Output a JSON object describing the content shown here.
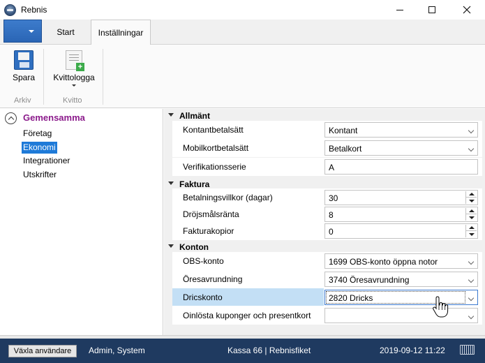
{
  "window": {
    "title": "Rebnis"
  },
  "tabs": {
    "start": "Start",
    "settings": "Inställningar"
  },
  "ribbon": {
    "save_label": "Spara",
    "archive_group": "Arkiv",
    "receipt_logo_label": "Kvittologga",
    "receipt_group": "Kvitto"
  },
  "tree": {
    "root": "Gemensamma",
    "items": [
      "Företag",
      "Ekonomi",
      "Integrationer",
      "Utskrifter"
    ],
    "selected": "Ekonomi"
  },
  "grid": {
    "categories": {
      "general": "Allmänt",
      "invoice": "Faktura",
      "accounts": "Konton"
    },
    "general": [
      {
        "name": "Kontantbetalsätt",
        "value": "Kontant"
      },
      {
        "name": "Mobilkortbetalsätt",
        "value": "Betalkort"
      },
      {
        "name": "Verifikationsserie",
        "value": "A"
      }
    ],
    "invoice": [
      {
        "name": "Betalningsvillkor (dagar)",
        "value": "30"
      },
      {
        "name": "Dröjsmålsränta",
        "value": "8"
      },
      {
        "name": "Fakturakopior",
        "value": "0"
      }
    ],
    "accounts": [
      {
        "name": "OBS-konto",
        "value": "1699 OBS-konto öppna notor"
      },
      {
        "name": "Öresavrundning",
        "value": "3740 Öresavrundning"
      },
      {
        "name": "Dricskonto",
        "value": "2820 Dricks"
      },
      {
        "name": "Oinlösta kuponger och presentkort",
        "value": ""
      }
    ]
  },
  "status": {
    "switch_user": "Växla användare",
    "user": "Admin, System",
    "register": "Kassa 66 | Rebnisfiket",
    "datetime": "2019-09-12 11:22"
  },
  "colors": {
    "status_bar": "#1f3a60",
    "tree_root": "#8b1a8b",
    "selection": "#1e7ad8",
    "highlight_row": "#c3dff5"
  }
}
